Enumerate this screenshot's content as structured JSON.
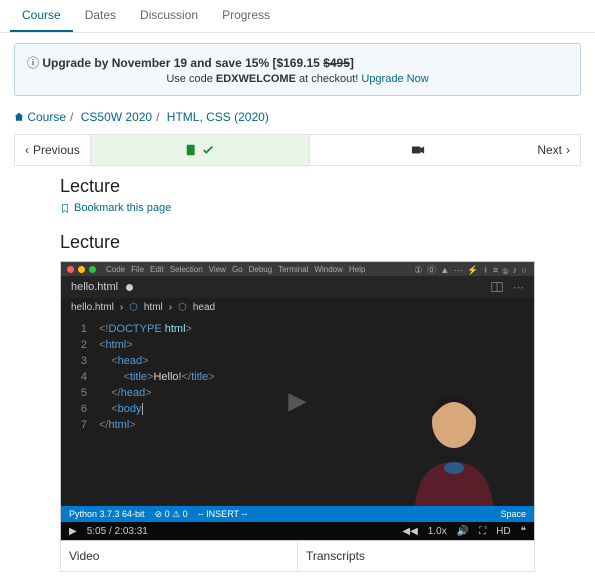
{
  "nav": {
    "tabs": [
      "Course",
      "Dates",
      "Discussion",
      "Progress"
    ],
    "active": 0
  },
  "promo": {
    "prefix": "Upgrade by November 19 and save 15% [",
    "price": "$169.15",
    "original": "$495",
    "suffix": "]",
    "line2a": "Use code ",
    "code": "EDXWELCOME",
    "line2b": " at checkout! ",
    "cta": "Upgrade Now"
  },
  "crumbs": {
    "home": "Course",
    "mid": "CS50W 2020",
    "leaf": "HTML, CSS (2020)"
  },
  "seq": {
    "prev": "Previous",
    "next": "Next"
  },
  "page": {
    "title": "Lecture",
    "bookmark": "Bookmark this page"
  },
  "video": {
    "heading": "Lecture",
    "mac_menus": [
      "Code",
      "File",
      "Edit",
      "Selection",
      "View",
      "Go",
      "Debug",
      "Terminal",
      "Window",
      "Help"
    ],
    "mac_right": "① ⓪ ▲ ⋯ ⚡ ᚼ ≡ ⓑ ♪ ○",
    "filename": "hello.html",
    "editor_crumbs": [
      "hello.html",
      "html",
      "head"
    ],
    "code_lines": [
      {
        "n": 1,
        "html": "<span class='doc'>&lt;!</span><span class='tag'>DOCTYPE</span> <span class='name'>html</span><span class='doc'>&gt;</span>"
      },
      {
        "n": 2,
        "html": "<span class='doc'>&lt;</span><span class='tag'>html</span><span class='doc'>&gt;</span>"
      },
      {
        "n": 3,
        "html": "&nbsp;&nbsp;&nbsp;&nbsp;<span class='doc'>&lt;</span><span class='tag'>head</span><span class='doc'>&gt;</span>"
      },
      {
        "n": 4,
        "html": "&nbsp;&nbsp;&nbsp;&nbsp;&nbsp;&nbsp;&nbsp;&nbsp;<span class='doc'>&lt;</span><span class='tag'>title</span><span class='doc'>&gt;</span>Hello!<span class='doc'>&lt;/</span><span class='tag'>title</span><span class='doc'>&gt;</span>"
      },
      {
        "n": 5,
        "html": "&nbsp;&nbsp;&nbsp;&nbsp;<span class='doc'>&lt;/</span><span class='tag'>head</span><span class='doc'>&gt;</span>"
      },
      {
        "n": 6,
        "html": "&nbsp;&nbsp;&nbsp;&nbsp;<span class='doc'>&lt;</span><span class='tag'>body</span><span class='cursor'></span>"
      },
      {
        "n": 7,
        "html": "<span class='doc'>&lt;/</span><span class='tag'>html</span><span class='doc'>&gt;</span>"
      }
    ],
    "status": {
      "left1": "Python 3.7.3 64-bit",
      "left2": "⊘ 0 ⚠ 0",
      "left3": "-- INSERT --",
      "right": "Space"
    },
    "controls": {
      "time": "5:05 / 2:03:31",
      "speed": "1.0x"
    },
    "tabs_below": [
      "Video",
      "Transcripts"
    ]
  }
}
